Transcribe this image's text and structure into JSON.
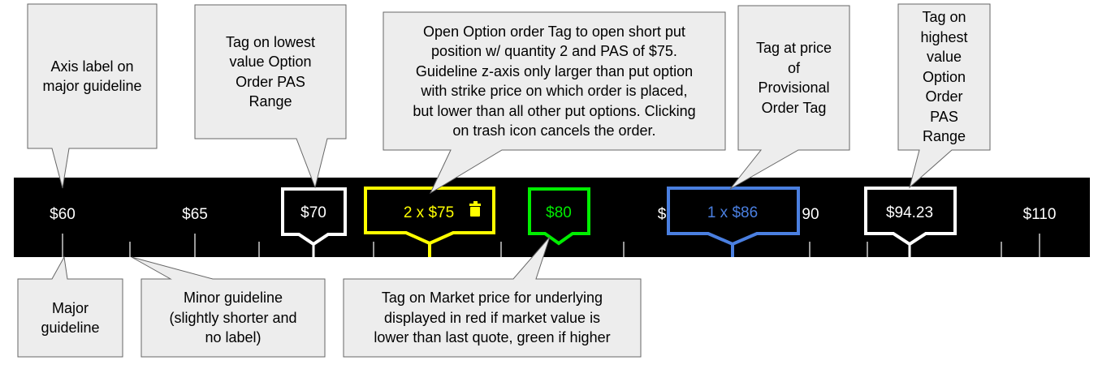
{
  "colors": {
    "axis_background": "#000000",
    "axis_text": "#ffffff",
    "callout_fill": "#ededed",
    "callout_stroke": "#666666",
    "range_tag": "#ffffff",
    "order_tag": "#ffff00",
    "market_tag": "#00ee00",
    "provisional_tag": "#4a7fe0"
  },
  "axis": {
    "major_labels": [
      "$60",
      "$65",
      "$110"
    ],
    "partial_labels": [
      "$",
      "90"
    ]
  },
  "tags": {
    "range_low": {
      "label": "$70"
    },
    "order": {
      "label": "2 x $75",
      "icon": "trash-icon"
    },
    "market": {
      "label": "$80"
    },
    "provisional": {
      "label": "1 x $86"
    },
    "range_high": {
      "label": "$94.23"
    }
  },
  "callouts": {
    "axis_label": [
      "Axis label on",
      "major guideline"
    ],
    "lowest_pas": [
      "Tag on lowest",
      "value Option",
      "Order PAS",
      "Range"
    ],
    "open_order": [
      "Open Option order Tag to open short put",
      "position w/ quantity 2 and PAS of $75.",
      "Guideline z-axis only larger than put option",
      "with strike price on which order is placed,",
      "but lower than all other put options. Clicking",
      "on trash icon cancels the order."
    ],
    "provisional": [
      "Tag at price",
      "of",
      "Provisional",
      "Order Tag"
    ],
    "highest_pas": [
      "Tag on",
      "highest",
      "value",
      "Option",
      "Order",
      "PAS",
      "Range"
    ],
    "major_guideline": [
      "Major",
      "guideline"
    ],
    "minor_guideline": [
      "Minor guideline",
      "(slightly shorter and",
      "no label)"
    ],
    "market_price": [
      "Tag on Market price for underlying",
      "displayed in red if market value is",
      "lower than last quote, green if higher"
    ]
  }
}
